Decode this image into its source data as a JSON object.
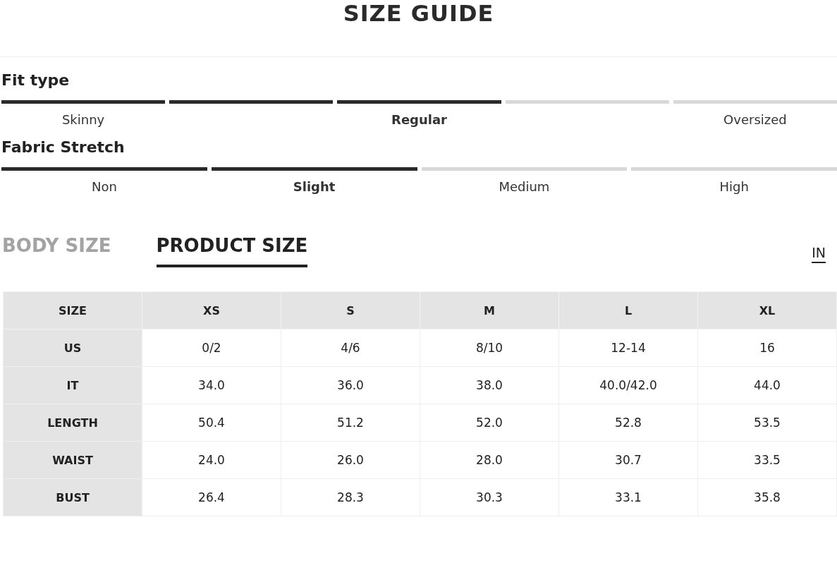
{
  "title": "SIZE GUIDE",
  "scales": [
    {
      "heading": "Fit type",
      "segments": [
        {
          "label": "Skinny",
          "filled": true,
          "selected": false
        },
        {
          "filled": true
        },
        {
          "label": "Regular",
          "filled": true,
          "selected": true
        },
        {
          "filled": false
        },
        {
          "label": "Oversized",
          "filled": false,
          "selected": false
        }
      ]
    },
    {
      "heading": "Fabric Stretch",
      "segments": [
        {
          "label": "Non",
          "filled": true,
          "selected": false
        },
        {
          "label": "Slight",
          "filled": true,
          "selected": true
        },
        {
          "label": "Medium",
          "filled": false,
          "selected": false
        },
        {
          "label": "High",
          "filled": false,
          "selected": false
        }
      ]
    }
  ],
  "tabs": [
    {
      "label": "BODY SIZE",
      "selected": false
    },
    {
      "label": "PRODUCT SIZE",
      "selected": true
    }
  ],
  "unit": "IN",
  "table": {
    "columns": [
      "SIZE",
      "XS",
      "S",
      "M",
      "L",
      "XL"
    ],
    "rows": [
      [
        "US",
        "0/2",
        "4/6",
        "8/10",
        "12-14",
        "16"
      ],
      [
        "IT",
        "34.0",
        "36.0",
        "38.0",
        "40.0/42.0",
        "44.0"
      ],
      [
        "LENGTH",
        "50.4",
        "51.2",
        "52.0",
        "52.8",
        "53.5"
      ],
      [
        "WAIST",
        "24.0",
        "26.0",
        "28.0",
        "30.7",
        "33.5"
      ],
      [
        "BUST",
        "26.4",
        "28.3",
        "30.3",
        "33.1",
        "35.8"
      ]
    ]
  }
}
